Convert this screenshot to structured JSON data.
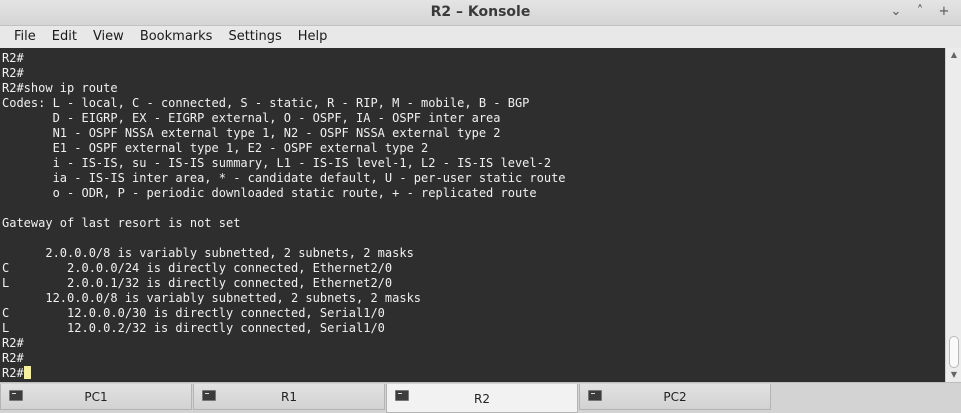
{
  "window": {
    "title": "R2 – Konsole",
    "buttons": {
      "minimize": "⌄",
      "maximize": "˄",
      "close": "+"
    }
  },
  "menubar": {
    "items": [
      "File",
      "Edit",
      "View",
      "Bookmarks",
      "Settings",
      "Help"
    ]
  },
  "terminal": {
    "lines": [
      "R2#",
      "R2#",
      "R2#show ip route",
      "Codes: L - local, C - connected, S - static, R - RIP, M - mobile, B - BGP",
      "       D - EIGRP, EX - EIGRP external, O - OSPF, IA - OSPF inter area",
      "       N1 - OSPF NSSA external type 1, N2 - OSPF NSSA external type 2",
      "       E1 - OSPF external type 1, E2 - OSPF external type 2",
      "       i - IS-IS, su - IS-IS summary, L1 - IS-IS level-1, L2 - IS-IS level-2",
      "       ia - IS-IS inter area, * - candidate default, U - per-user static route",
      "       o - ODR, P - periodic downloaded static route, + - replicated route",
      "",
      "Gateway of last resort is not set",
      "",
      "      2.0.0.0/8 is variably subnetted, 2 subnets, 2 masks",
      "C        2.0.0.0/24 is directly connected, Ethernet2/0",
      "L        2.0.0.1/32 is directly connected, Ethernet2/0",
      "      12.0.0.0/8 is variably subnetted, 2 subnets, 2 masks",
      "C        12.0.0.0/30 is directly connected, Serial1/0",
      "L        12.0.0.2/32 is directly connected, Serial1/0",
      "R2#",
      "R2#"
    ],
    "prompt": "R2#"
  },
  "tabs": [
    {
      "label": "PC1",
      "active": false
    },
    {
      "label": "R1",
      "active": false
    },
    {
      "label": "R2",
      "active": true
    },
    {
      "label": "PC2",
      "active": false
    }
  ],
  "icons": {
    "tab_icon": "terminal-icon",
    "scroll_up": "arrow-up-icon",
    "scroll_down": "arrow-down-icon"
  },
  "colors": {
    "terminal_bg": "#2e2e2e",
    "terminal_fg": "#f0f0f0",
    "cursor": "#f5f0a0"
  }
}
